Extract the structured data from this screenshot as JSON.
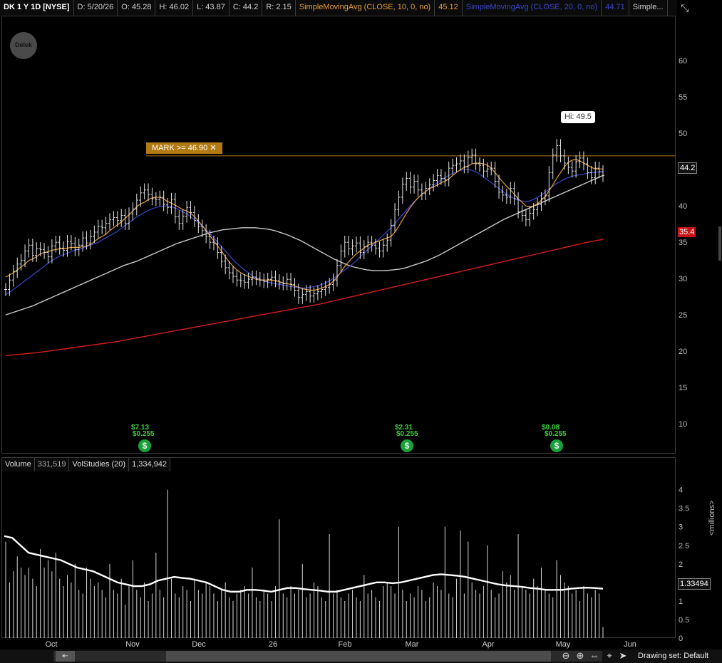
{
  "header": {
    "symbol": "DK 1 Y 1D [NYSE]",
    "date": "D: 5/20/26",
    "open": "O: 45.28",
    "high": "H: 46.02",
    "low": "L: 43.87",
    "close": "C: 44.2",
    "range": "R: 2.15",
    "sma10_label": "SimpleMovingAvg (CLOSE, 10, 0, no)",
    "sma10_value": "45.12",
    "sma20_label": "SimpleMovingAvg (CLOSE, 20, 0, no)",
    "sma20_value": "44.71",
    "more_label": "Simple..."
  },
  "colors": {
    "sma10": "#e39c3c",
    "sma20": "#3b46c9",
    "sma50": "#c9c9c9",
    "sma200": "#d51e1e",
    "mark_line": "#b27a12",
    "bars": "#e6e6e6",
    "vol_avg": "#ffffff"
  },
  "logo": {
    "text": "Delek"
  },
  "price_annotations": {
    "mark_alert": "MARK >= 46.90",
    "mark_close_icon": "✕",
    "hi_label": "Hi: 49.5",
    "last_price": "44.2",
    "sma200_badge": "35.4"
  },
  "events": [
    {
      "top": "$7.13",
      "bottom": "$0.255"
    },
    {
      "top": "$2.31",
      "bottom": "$0.255"
    },
    {
      "top": "$0.08",
      "bottom": "$0.255"
    }
  ],
  "event_icon": "$",
  "volume_header": {
    "label": "Volume",
    "value": "331,519",
    "study_label": "VolStudies (20)",
    "study_value": "1,334,942"
  },
  "volume_axis": {
    "unit": "<millions>",
    "last_avg": "1.33494"
  },
  "footer": {
    "drawing_set": "Drawing set: Default"
  },
  "chart_data": [
    {
      "type": "ohlc",
      "y_ticks": [
        "60",
        "55",
        "50",
        "45",
        "40",
        "35",
        "30",
        "25",
        "20",
        "15",
        "10"
      ],
      "ylim": [
        6,
        66
      ],
      "x_ticks": [
        "Oct",
        "Nov",
        "Dec",
        "26",
        "Feb",
        "Mar",
        "Apr",
        "May",
        "Jun"
      ],
      "mark_level": 46.9,
      "high_annotation": 49.5,
      "closes": [
        28.5,
        29.8,
        31.0,
        32.0,
        32.5,
        33.8,
        34.6,
        33.2,
        34.1,
        34.0,
        33.6,
        33.0,
        34.5,
        35.0,
        34.2,
        33.9,
        35.1,
        34.8,
        34.0,
        34.6,
        35.6,
        34.9,
        35.8,
        36.4,
        37.2,
        37.0,
        37.6,
        38.1,
        38.4,
        38.0,
        38.7,
        37.6,
        38.9,
        39.6,
        40.8,
        41.8,
        42.2,
        41.6,
        41.0,
        40.9,
        41.2,
        40.2,
        39.8,
        40.9,
        38.5,
        37.6,
        38.6,
        39.8,
        39.1,
        38.0,
        37.2,
        36.6,
        35.8,
        35.0,
        34.8,
        33.6,
        32.4,
        31.5,
        30.8,
        30.3,
        29.8,
        29.7,
        29.5,
        29.9,
        30.2,
        30.0,
        29.8,
        29.6,
        29.9,
        30.2,
        29.7,
        29.4,
        29.3,
        29.9,
        29.2,
        28.4,
        27.4,
        27.8,
        28.2,
        27.6,
        27.9,
        28.2,
        28.5,
        28.8,
        29.2,
        29.8,
        31.8,
        33.8,
        35.0,
        34.1,
        34.5,
        34.9,
        33.6,
        34.4,
        35.0,
        34.6,
        34.2,
        33.8,
        34.6,
        35.3,
        37.3,
        39.5,
        41.2,
        43.0,
        43.8,
        42.6,
        43.4,
        42.2,
        41.7,
        42.4,
        42.9,
        43.5,
        44.2,
        43.8,
        43.6,
        45.2,
        45.6,
        45.8,
        46.2,
        45.4,
        46.7,
        47.0,
        45.8,
        45.6,
        44.8,
        45.1,
        45.2,
        43.4,
        41.9,
        41.5,
        41.2,
        42.4,
        41.0,
        39.2,
        38.7,
        38.1,
        39.0,
        39.5,
        40.2,
        41.0,
        41.4,
        44.6,
        47.0,
        48.3,
        46.9,
        45.9,
        45.3,
        44.8,
        46.1,
        46.6,
        45.8,
        44.6,
        43.9,
        45.2,
        44.7,
        44.2
      ],
      "sma10": [
        30.2,
        30.5,
        30.8,
        31.2,
        31.6,
        32.0,
        32.5,
        32.7,
        33.0,
        33.4,
        33.6,
        33.7,
        33.9,
        34.0,
        34.1,
        34.1,
        34.2,
        34.3,
        34.3,
        34.3,
        34.4,
        34.5,
        34.7,
        35.1,
        35.5,
        35.8,
        36.1,
        36.6,
        37.0,
        37.4,
        37.8,
        38.3,
        38.8,
        39.3,
        39.9,
        40.3,
        40.5,
        40.9,
        41.1,
        41.2,
        41.2,
        41.0,
        40.6,
        40.4,
        40.1,
        39.8,
        39.5,
        39.3,
        39.0,
        38.5,
        37.9,
        37.3,
        36.6,
        35.9,
        35.2,
        34.5,
        33.8,
        33.0,
        32.3,
        31.7,
        31.2,
        30.8,
        30.5,
        30.3,
        30.1,
        29.9,
        29.8,
        29.8,
        29.8,
        29.8,
        29.7,
        29.6,
        29.4,
        29.3,
        29.2,
        29.0,
        28.8,
        28.6,
        28.5,
        28.4,
        28.4,
        28.5,
        28.7,
        28.9,
        29.2,
        29.6,
        30.2,
        30.9,
        31.7,
        32.3,
        32.9,
        33.4,
        33.8,
        34.2,
        34.6,
        34.8,
        35.0,
        35.2,
        35.4,
        35.6,
        35.8,
        36.4,
        37.2,
        38.1,
        39.0,
        39.8,
        40.5,
        41.1,
        41.6,
        42.0,
        42.4,
        42.6,
        42.9,
        43.2,
        43.4,
        43.7,
        44.2,
        44.6,
        45.0,
        45.3,
        45.5,
        45.8,
        45.9,
        45.9,
        45.8,
        45.6,
        45.2,
        44.6,
        43.9,
        43.3,
        42.7,
        42.2,
        41.6,
        41.0,
        40.5,
        40.0,
        39.9,
        40.0,
        40.3,
        40.8,
        41.3,
        42.1,
        42.9,
        43.8,
        44.6,
        45.4,
        46.0,
        46.3,
        46.4,
        46.2,
        45.9,
        45.6,
        45.3,
        45.1,
        45.1,
        45.1
      ],
      "sma20": [
        27.8,
        28.1,
        28.5,
        28.9,
        29.3,
        29.7,
        30.1,
        30.5,
        30.9,
        31.3,
        31.7,
        32.1,
        32.5,
        32.8,
        33.1,
        33.3,
        33.5,
        33.7,
        33.9,
        34.0,
        34.2,
        34.4,
        34.6,
        34.8,
        35.0,
        35.3,
        35.6,
        35.9,
        36.2,
        36.5,
        36.9,
        37.3,
        37.7,
        38.1,
        38.5,
        38.8,
        39.1,
        39.4,
        39.6,
        39.8,
        39.9,
        40.0,
        40.0,
        39.9,
        39.7,
        39.5,
        39.2,
        38.9,
        38.5,
        38.1,
        37.7,
        37.2,
        36.7,
        36.2,
        35.6,
        35.0,
        34.4,
        33.8,
        33.2,
        32.6,
        32.1,
        31.6,
        31.2,
        30.8,
        30.4,
        30.1,
        29.9,
        29.7,
        29.5,
        29.4,
        29.3,
        29.2,
        29.1,
        29.0,
        28.9,
        28.8,
        28.8,
        28.7,
        28.7,
        28.8,
        28.9,
        29.0,
        29.2,
        29.4,
        29.7,
        30.0,
        30.4,
        30.8,
        31.2,
        31.6,
        32.0,
        32.5,
        33.0,
        33.5,
        34.0,
        34.5,
        35.0,
        35.5,
        36.0,
        36.5,
        37.0,
        37.6,
        38.2,
        38.8,
        39.4,
        40.0,
        40.6,
        41.1,
        41.6,
        42.0,
        42.4,
        42.8,
        43.2,
        43.6,
        43.9,
        44.2,
        44.5,
        44.7,
        44.9,
        45.0,
        45.0,
        44.9,
        44.7,
        44.4,
        44.0,
        43.6,
        43.2,
        42.8,
        42.4,
        42.0,
        41.6,
        41.3,
        41.0,
        40.8,
        40.7,
        40.6,
        40.7,
        40.9,
        41.2,
        41.5,
        41.9,
        42.3,
        42.7,
        43.1,
        43.4,
        43.7,
        43.9,
        44.1,
        44.2,
        44.3,
        44.4,
        44.5,
        44.6,
        44.6,
        44.7,
        44.7
      ],
      "sma50": [
        25.0,
        25.3,
        25.6,
        25.9,
        26.2,
        26.6,
        27.0,
        27.4,
        27.8,
        28.2,
        28.6,
        29.0,
        29.4,
        29.8,
        30.2,
        30.6,
        31.0,
        31.4,
        31.8,
        32.1,
        32.4,
        32.8,
        33.2,
        33.6,
        34.0,
        34.4,
        34.8,
        35.1,
        35.4,
        35.7,
        36.0,
        36.3,
        36.5,
        36.7,
        36.8,
        36.9,
        37.0,
        37.0,
        37.0,
        36.9,
        36.8,
        36.6,
        36.3,
        36.0,
        35.6,
        35.2,
        34.7,
        34.2,
        33.7,
        33.2,
        32.7,
        32.3,
        31.9,
        31.6,
        31.4,
        31.2,
        31.1,
        31.1,
        31.1,
        31.2,
        31.3,
        31.5,
        31.8,
        32.1,
        32.4,
        32.8,
        33.2,
        33.7,
        34.2,
        34.7,
        35.2,
        35.7,
        36.2,
        36.7,
        37.2,
        37.7,
        38.2,
        38.6,
        39.0,
        39.4,
        39.8,
        40.2,
        40.6,
        41.0,
        41.4,
        41.8,
        42.2,
        42.6,
        43.0,
        43.4,
        43.8,
        44.2
      ],
      "sma200": [
        19.4,
        19.6,
        19.8,
        20.1,
        20.4,
        20.7,
        21.0,
        21.3,
        21.7,
        22.1,
        22.5,
        22.9,
        23.3,
        23.7,
        24.1,
        24.5,
        24.9,
        25.3,
        25.7,
        26.1,
        26.5,
        27.0,
        27.5,
        28.0,
        28.5,
        29.0,
        29.5,
        30.0,
        30.5,
        31.0,
        31.5,
        32.0,
        32.5,
        33.0,
        33.5,
        34.0,
        34.5,
        35.0,
        35.4
      ],
      "earnings_events": [
        {
          "eps": "$7.13",
          "dividend": "$0.255"
        },
        {
          "eps": "$2.31",
          "dividend": "$0.255"
        },
        {
          "eps": "$0.08",
          "dividend": "$0.255"
        }
      ]
    },
    {
      "type": "bar",
      "name": "Volume",
      "y_ticks": [
        "4",
        "3.5",
        "3",
        "2.5",
        "2",
        "1.5",
        "1",
        "0.5",
        "0"
      ],
      "ylim": [
        0,
        4.3
      ],
      "ylabel": "<millions>",
      "volumes": [
        2.6,
        1.5,
        1.8,
        2.2,
        1.9,
        1.7,
        1.9,
        1.6,
        1.4,
        2.4,
        1.9,
        2.1,
        1.8,
        2.3,
        1.6,
        1.4,
        1.7,
        1.5,
        2.0,
        1.3,
        1.2,
        1.9,
        1.6,
        1.4,
        1.5,
        1.3,
        1.1,
        2.0,
        1.3,
        1.2,
        1.6,
        0.9,
        1.4,
        2.1,
        1.3,
        1.1,
        1.5,
        1.0,
        1.2,
        2.3,
        1.3,
        1.1,
        4.0,
        1.6,
        1.2,
        1.1,
        1.4,
        1.3,
        1.0,
        1.6,
        1.3,
        1.2,
        1.5,
        1.4,
        1.2,
        1.0,
        1.3,
        1.5,
        1.1,
        1.0,
        1.2,
        1.3,
        1.4,
        1.2,
        1.9,
        1.1,
        1.0,
        1.3,
        1.2,
        1.0,
        1.4,
        3.2,
        1.2,
        1.1,
        1.4,
        1.2,
        1.3,
        2.0,
        1.1,
        1.2,
        1.5,
        1.4,
        1.1,
        1.0,
        2.8,
        1.2,
        1.3,
        1.1,
        1.0,
        1.2,
        1.3,
        1.1,
        1.0,
        1.7,
        1.2,
        1.3,
        1.1,
        1.0,
        1.4,
        1.5,
        1.4,
        1.2,
        3.0,
        1.3,
        1.0,
        1.2,
        1.1,
        1.4,
        1.3,
        1.0,
        1.1,
        1.5,
        1.4,
        1.3,
        3.0,
        1.2,
        1.1,
        1.6,
        2.9,
        1.2,
        2.6,
        1.5,
        1.3,
        1.2,
        1.4,
        2.5,
        1.3,
        1.1,
        1.2,
        1.8,
        1.5,
        1.7,
        1.3,
        2.8,
        1.4,
        1.3,
        1.2,
        1.6,
        1.4,
        1.9,
        1.3,
        1.2,
        1.1,
        2.1,
        1.7,
        1.5,
        1.4,
        1.2,
        1.3,
        1.0,
        1.4,
        1.2,
        1.1,
        1.3,
        1.2,
        0.3
      ],
      "vol_avg": [
        2.75,
        2.7,
        2.5,
        2.3,
        2.25,
        2.2,
        2.15,
        2.1,
        2.0,
        1.9,
        1.85,
        1.8,
        1.7,
        1.6,
        1.5,
        1.45,
        1.4,
        1.4,
        1.45,
        1.55,
        1.6,
        1.65,
        1.62,
        1.6,
        1.55,
        1.5,
        1.4,
        1.3,
        1.25,
        1.25,
        1.3,
        1.3,
        1.28,
        1.25,
        1.3,
        1.35,
        1.35,
        1.32,
        1.3,
        1.28,
        1.25,
        1.25,
        1.3,
        1.35,
        1.4,
        1.45,
        1.5,
        1.5,
        1.48,
        1.5,
        1.55,
        1.6,
        1.65,
        1.7,
        1.72,
        1.7,
        1.68,
        1.65,
        1.6,
        1.55,
        1.5,
        1.45,
        1.42,
        1.4,
        1.38,
        1.35,
        1.33,
        1.3,
        1.3,
        1.3,
        1.33,
        1.35,
        1.36,
        1.35,
        1.33
      ]
    }
  ]
}
